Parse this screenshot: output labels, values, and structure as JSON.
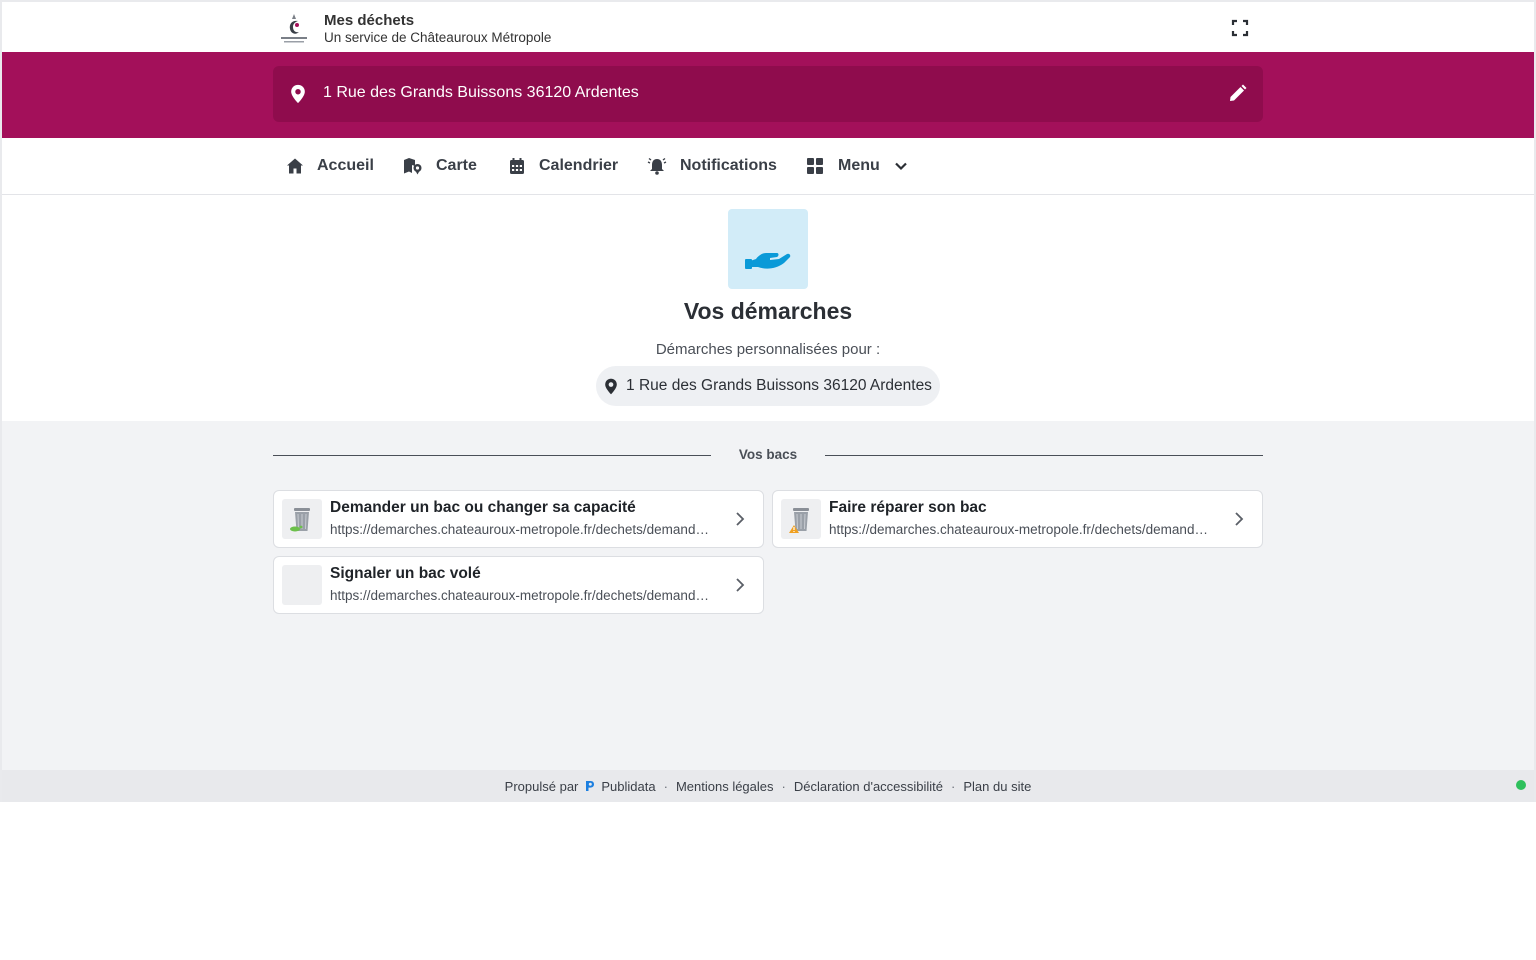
{
  "header": {
    "title": "Mes déchets",
    "subtitle": "Un service de Châteauroux Métropole",
    "logo_icon": "chateauroux-metropole-logo",
    "fullscreen_icon": "fullscreen-icon"
  },
  "address_bar": {
    "address": "1 Rue des Grands Buissons 36120 Ardentes",
    "pin_icon": "map-pin-icon",
    "edit_icon": "pencil-icon"
  },
  "nav": {
    "items": [
      {
        "label": "Accueil",
        "icon": "home-icon"
      },
      {
        "label": "Carte",
        "icon": "map-icon"
      },
      {
        "label": "Calendrier",
        "icon": "calendar-icon"
      },
      {
        "label": "Notifications",
        "icon": "bell-icon"
      },
      {
        "label": "Menu",
        "icon": "grid-icon"
      }
    ]
  },
  "hero": {
    "icon": "hand-icon",
    "title": "Vos démarches",
    "subtitle": "Démarches personnalisées pour :",
    "address": "1 Rue des Grands Buissons 36120 Ardentes"
  },
  "section": {
    "label": "Vos bacs",
    "cards": [
      {
        "title": "Demander un bac ou changer sa capacité",
        "url": "https://demarches.chateauroux-metropole.fr/dechets/demande-de-bac",
        "icon": "bin-add-icon"
      },
      {
        "title": "Faire réparer son bac",
        "url": "https://demarches.chateauroux-metropole.fr/dechets/demande-reparation",
        "icon": "bin-warning-icon"
      },
      {
        "title": "Signaler un bac volé",
        "url": "https://demarches.chateauroux-metropole.fr/dechets/demande-vol",
        "icon": "placeholder-icon"
      }
    ]
  },
  "footer": {
    "powered_by": "Propulsé par",
    "brand": "Publidata",
    "legal": "Mentions légales",
    "accessibility": "Déclaration d'accessibilité",
    "sitemap": "Plan du site"
  },
  "colors": {
    "brand": "#a3105a",
    "brand_dark": "#8f0c4d",
    "hero_bg": "#d2ecf8",
    "hero_icon": "#0a9ad8",
    "status": "#2ec05c"
  }
}
